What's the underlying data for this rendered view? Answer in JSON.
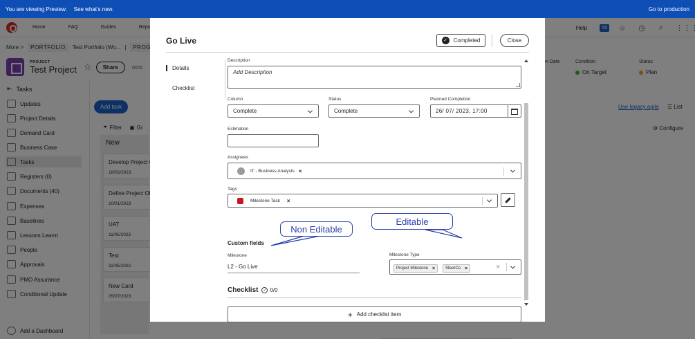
{
  "banner": {
    "message": "You are viewing Preview.",
    "whats_new": "See what's new.",
    "go_production": "Go to production"
  },
  "nav": {
    "items": [
      "Home",
      "FAQ",
      "Guides",
      "Report"
    ],
    "help": "Help",
    "badge": "56"
  },
  "breadcrumb": {
    "more": "More >",
    "portfolio": "PORTFOLIO",
    "test_portfolio": "Test Portfolio (Wo...",
    "sep": "|",
    "program": "PROGRAM"
  },
  "project": {
    "label": "PROJECT",
    "name": "Test Project",
    "share": "Share",
    "more": "ooo"
  },
  "header_cols": {
    "date_label": "on Date",
    "condition_label": "Condition",
    "condition_value": "On Target",
    "condition_color": "#3fae3f",
    "status_label": "Status",
    "status_value": "Plan",
    "status_color": "#f0a020"
  },
  "sidebar": {
    "tasks_header": "Tasks",
    "items": [
      "Updates",
      "Project Details",
      "Demand Card",
      "Business Case",
      "Tasks",
      "Registers (0)",
      "Documents (40)",
      "Expenses",
      "Baselines",
      "Lessons Learnt",
      "People",
      "Approvals",
      "PMO Assurance",
      "Conditional Update"
    ],
    "add_dashboard": "Add a Dashboard"
  },
  "board": {
    "add_task": "Add task",
    "filter": "Filter",
    "group": "Gr",
    "legacy": "Use legacy agile",
    "list": "List",
    "configure": "Configure",
    "column_title": "New",
    "cards": [
      {
        "title": "Develop Project C",
        "date": "18/02/2023"
      },
      {
        "title": "Define Project Ob",
        "date": "10/01/2023"
      },
      {
        "title": "UAT",
        "date": "11/05/2023"
      },
      {
        "title": "Test",
        "date": "11/05/2023"
      },
      {
        "title": "New Card",
        "date": "05/07/2023"
      }
    ]
  },
  "modal": {
    "title": "Go Live",
    "completed": "Completed",
    "close": "Close",
    "tabs": [
      "Details",
      "Checklist"
    ],
    "description": {
      "label": "Description",
      "placeholder": "Add Description"
    },
    "column": {
      "label": "Column",
      "value": "Complete"
    },
    "status": {
      "label": "Status",
      "value": "Complete"
    },
    "planned_completion": {
      "label": "Planned Completion",
      "value": "26/ 07/ 2023, 17:00"
    },
    "estimation": {
      "label": "Estimation",
      "value": ""
    },
    "assignees": {
      "label": "Assignees",
      "value": "IT - Business Analysts"
    },
    "tags": {
      "label": "Tags",
      "value": "Milestone Task",
      "tag_color": "#c8181e"
    },
    "custom_fields": "Custom fields",
    "milestone": {
      "label": "Milestone",
      "value": "L2 - Go Live"
    },
    "milestone_type": {
      "label": "Milestone Type",
      "chips": [
        "Project Milestone",
        "SteerCo"
      ]
    },
    "checklist": {
      "title": "Checklist",
      "count": "0/0",
      "add": "Add checklist item"
    }
  },
  "annotations": {
    "non_editable": "Non Editable",
    "editable": "Editable"
  }
}
